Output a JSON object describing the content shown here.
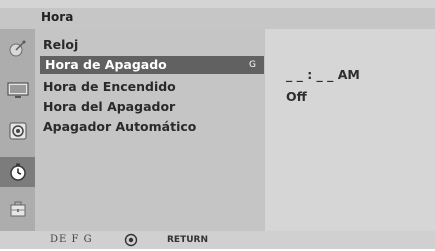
{
  "header": {
    "title": "Hora"
  },
  "sidebar": {
    "icons": [
      {
        "name": "satellite-dish-icon"
      },
      {
        "name": "monitor-icon"
      },
      {
        "name": "speaker-icon"
      },
      {
        "name": "clock-icon",
        "active": true
      },
      {
        "name": "toolbox-icon"
      }
    ]
  },
  "menu": {
    "items": [
      {
        "label": "Reloj"
      },
      {
        "label": "Hora de Apagado",
        "selected": true,
        "key_hint": "G"
      },
      {
        "label": "Hora de Encendido"
      },
      {
        "label": "Hora del Apagador"
      },
      {
        "label": "Apagador Automático"
      }
    ]
  },
  "values": {
    "time": "_ _ : _ _ AM",
    "status": "Off"
  },
  "footer": {
    "nav_keys": "DE  F G",
    "ok_icon": "ok-button-icon",
    "return_label": "RETURN"
  },
  "colors": {
    "selected_bg": "#616161",
    "menu_bg": "#c5c5c5",
    "icon_bg": "#adadad"
  }
}
